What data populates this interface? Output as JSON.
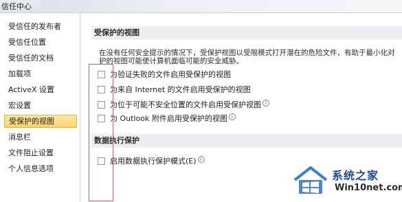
{
  "window": {
    "title": "信任中心"
  },
  "sidebar": {
    "items": [
      {
        "label": "受信任的发布者",
        "selected": false
      },
      {
        "label": "受信任位置",
        "selected": false
      },
      {
        "label": "受信任的文档",
        "selected": false
      },
      {
        "label": "加载项",
        "selected": false
      },
      {
        "label": "ActiveX 设置",
        "selected": false
      },
      {
        "label": "宏设置",
        "selected": false
      },
      {
        "label": "受保护的视图",
        "selected": true
      },
      {
        "label": "消息栏",
        "selected": false
      },
      {
        "label": "文件阻止设置",
        "selected": false
      },
      {
        "label": "个人信息选项",
        "selected": false
      }
    ]
  },
  "protected_view": {
    "header": "受保护的视图",
    "description_line1": "在没有任何安全提示的情况下，受保护视图以受限模式打开潜在的危险文件，有助于最小化对",
    "description_line2": "护的视图可能使计算机面临可能的安全威胁。",
    "options": [
      {
        "label": "为验证失败的文件启用受保护的视图",
        "checked": false,
        "has_info": false
      },
      {
        "label": "为来自 Internet 的文件启用受保护的视图",
        "checked": false,
        "has_info": false
      },
      {
        "label": "为位于可能不安全位置的文件启用受保护视图",
        "checked": false,
        "has_info": true
      },
      {
        "label": "为 Outlook 附件启用受保护的视图",
        "checked": false,
        "has_info": true
      }
    ]
  },
  "dep": {
    "header": "数据执行保护",
    "option": {
      "label": "启用数据执行保护模式(E)",
      "checked": false,
      "has_info": true
    }
  },
  "watermark": {
    "text1": "系统之家",
    "text2": "Win10net.com"
  },
  "colors": {
    "selection_fill": "#fbd46a",
    "selection_border": "#e8b23a",
    "section_header_bg": "#edeef1",
    "annotation_red": "#e05a5a",
    "watermark_blue": "#1d4a8f"
  },
  "icons": {
    "info": "info-icon",
    "logo": "windows-house-logo"
  }
}
